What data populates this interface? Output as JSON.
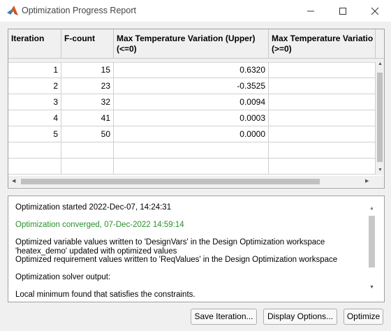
{
  "window": {
    "title": "Optimization Progress Report",
    "brand_color": "#d9531e"
  },
  "table": {
    "columns": [
      {
        "line1": "Iteration",
        "line2": ""
      },
      {
        "line1": "F-count",
        "line2": ""
      },
      {
        "line1": "Max Temperature Variation (Upper)",
        "line2": "(<=0)"
      },
      {
        "line1": "Max Temperature Variatio",
        "line2": "(>=0)"
      }
    ],
    "rows": [
      {
        "iteration": "1",
        "fcount": "15",
        "upper": "0.6320",
        "lower": ""
      },
      {
        "iteration": "2",
        "fcount": "23",
        "upper": "-0.3525",
        "lower": ""
      },
      {
        "iteration": "3",
        "fcount": "32",
        "upper": "0.0094",
        "lower": ""
      },
      {
        "iteration": "4",
        "fcount": "41",
        "upper": "0.0003",
        "lower": ""
      },
      {
        "iteration": "5",
        "fcount": "50",
        "upper": "0.0000",
        "lower": ""
      }
    ]
  },
  "log": {
    "started": "Optimization started 2022-Dec-07, 14:24:31",
    "converged": "Optimization converged, 07-Dec-2022 14:59:14",
    "converged_color": "#2c8f2c",
    "line_vars": "Optimized variable values written to 'DesignVars' in the Design Optimization workspace",
    "line_model": "'heatex_demo' updated with optimized values",
    "line_req": "Optimized requirement values written to 'ReqValues' in the Design Optimization workspace",
    "solver_label": "Optimization solver output:",
    "result": "Local minimum found that satisfies the constraints."
  },
  "buttons": {
    "save_iteration": "Save Iteration...",
    "display_options": "Display Options...",
    "optimize": "Optimize"
  },
  "icons": {
    "app": "matlab-icon",
    "minimize": "minimize-icon",
    "maximize": "maximize-icon",
    "close": "close-icon"
  }
}
